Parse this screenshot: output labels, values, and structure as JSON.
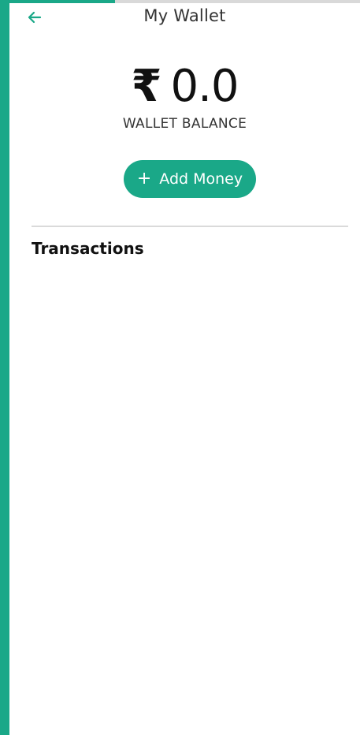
{
  "header": {
    "title": "My Wallet",
    "back_icon": "arrow-left-icon"
  },
  "progress": {
    "fraction": 0.3
  },
  "wallet": {
    "currency_symbol": "₹",
    "amount": "0.0",
    "balance_label": "WALLET BALANCE"
  },
  "actions": {
    "add_money_icon": "plus-icon",
    "add_money_label": "Add Money"
  },
  "transactions": {
    "heading": "Transactions",
    "items": []
  },
  "colors": {
    "accent": "#1aa888",
    "text_primary": "#111111",
    "divider": "#dadada"
  }
}
